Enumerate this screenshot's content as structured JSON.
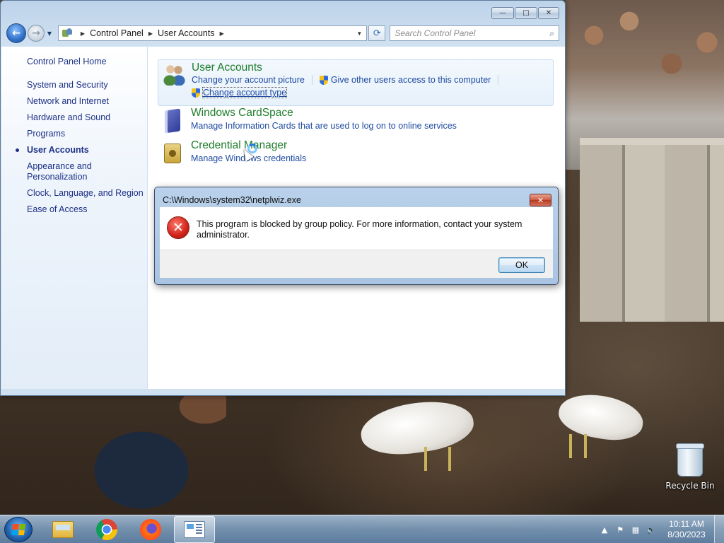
{
  "window": {
    "caption_min": "—",
    "caption_max": "□",
    "caption_close": "✕"
  },
  "navigation": {
    "back_glyph": "←",
    "forward_glyph": "→",
    "address_crumbs": [
      "Control Panel",
      "User Accounts"
    ],
    "refresh_glyph": "⟳",
    "search_placeholder": "Search Control Panel",
    "search_glyph": "⌕"
  },
  "sidebar": {
    "home": "Control Panel Home",
    "items": [
      {
        "label": "System and Security"
      },
      {
        "label": "Network and Internet"
      },
      {
        "label": "Hardware and Sound"
      },
      {
        "label": "Programs"
      },
      {
        "label": "User Accounts",
        "active": true
      },
      {
        "label": "Appearance and",
        "label2": "Personalization"
      },
      {
        "label": "Clock, Language, and Region"
      },
      {
        "label": "Ease of Access"
      }
    ]
  },
  "categories": [
    {
      "title": "User Accounts",
      "icon": "user-accounts-icon",
      "links": [
        "Change your account picture",
        "Give other users access to this computer",
        "Change account type"
      ]
    },
    {
      "title": "Windows CardSpace",
      "icon": "cardspace-icon",
      "links": [
        "Manage Information Cards that are used to log on to online services"
      ]
    },
    {
      "title": "Credential Manager",
      "icon": "credential-manager-icon",
      "links": [
        "Manage Windows credentials"
      ]
    }
  ],
  "dialog": {
    "title": "C:\\Windows\\system32\\netplwiz.exe",
    "close_glyph": "✕",
    "icon": "error-icon",
    "icon_glyph": "✕",
    "message": "This program is blocked by group policy. For more information, contact your system administrator.",
    "ok_label": "OK"
  },
  "desktop": {
    "recycle_bin_label": "Recycle Bin"
  },
  "taskbar": {
    "apps": [
      "windows-explorer-icon",
      "chrome-icon",
      "firefox-icon",
      "control-panel-icon"
    ],
    "tray": {
      "expand_glyph": "▲",
      "flag_glyph": "⚑",
      "network_glyph": "▦",
      "volume_glyph": "🔈",
      "time": "10:11 AM",
      "date": "8/30/2023"
    }
  },
  "colors": {
    "link": "#1f4aa0",
    "category_title": "#1e7d2c",
    "sidebar_link": "#1e3287",
    "error_red": "#d0231b"
  }
}
